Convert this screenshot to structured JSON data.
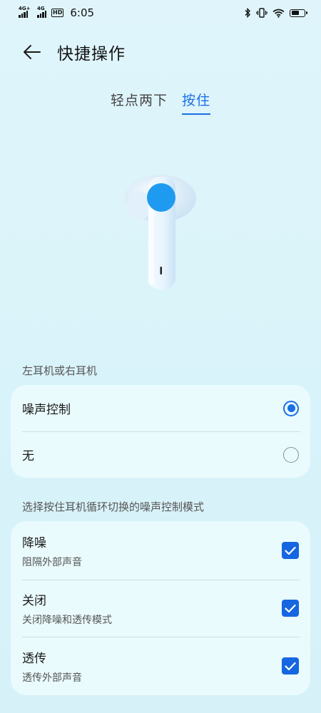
{
  "status_bar": {
    "sim1_label": "4G+",
    "sim2_label": "4G",
    "hd_badge": "HD",
    "time": "6:05",
    "battery_level": 0.6,
    "icons": [
      "signal-icon",
      "hd-icon",
      "bluetooth-icon",
      "vibrate-icon",
      "wifi-icon",
      "battery-icon"
    ]
  },
  "header": {
    "back_icon": "back-arrow-icon",
    "title": "快捷操作"
  },
  "tabs": [
    {
      "label": "轻点两下",
      "active": false
    },
    {
      "label": "按住",
      "active": true
    }
  ],
  "illustration": {
    "name": "earbud-image",
    "highlight_color": "#1e9bf0"
  },
  "section1": {
    "label": "左耳机或右耳机",
    "options": [
      {
        "label": "噪声控制",
        "selected": true
      },
      {
        "label": "无",
        "selected": false
      }
    ]
  },
  "section2": {
    "label": "选择按住耳机循环切换的噪声控制模式",
    "modes": [
      {
        "title": "降噪",
        "subtitle": "阻隔外部声音",
        "checked": true
      },
      {
        "title": "关闭",
        "subtitle": "关闭降噪和透传模式",
        "checked": true
      },
      {
        "title": "透传",
        "subtitle": "透传外部声音",
        "checked": true
      }
    ]
  },
  "colors": {
    "accent": "#1a6fe6",
    "card_bg": "#eafbfd",
    "page_bg": "#dcf4fa"
  }
}
